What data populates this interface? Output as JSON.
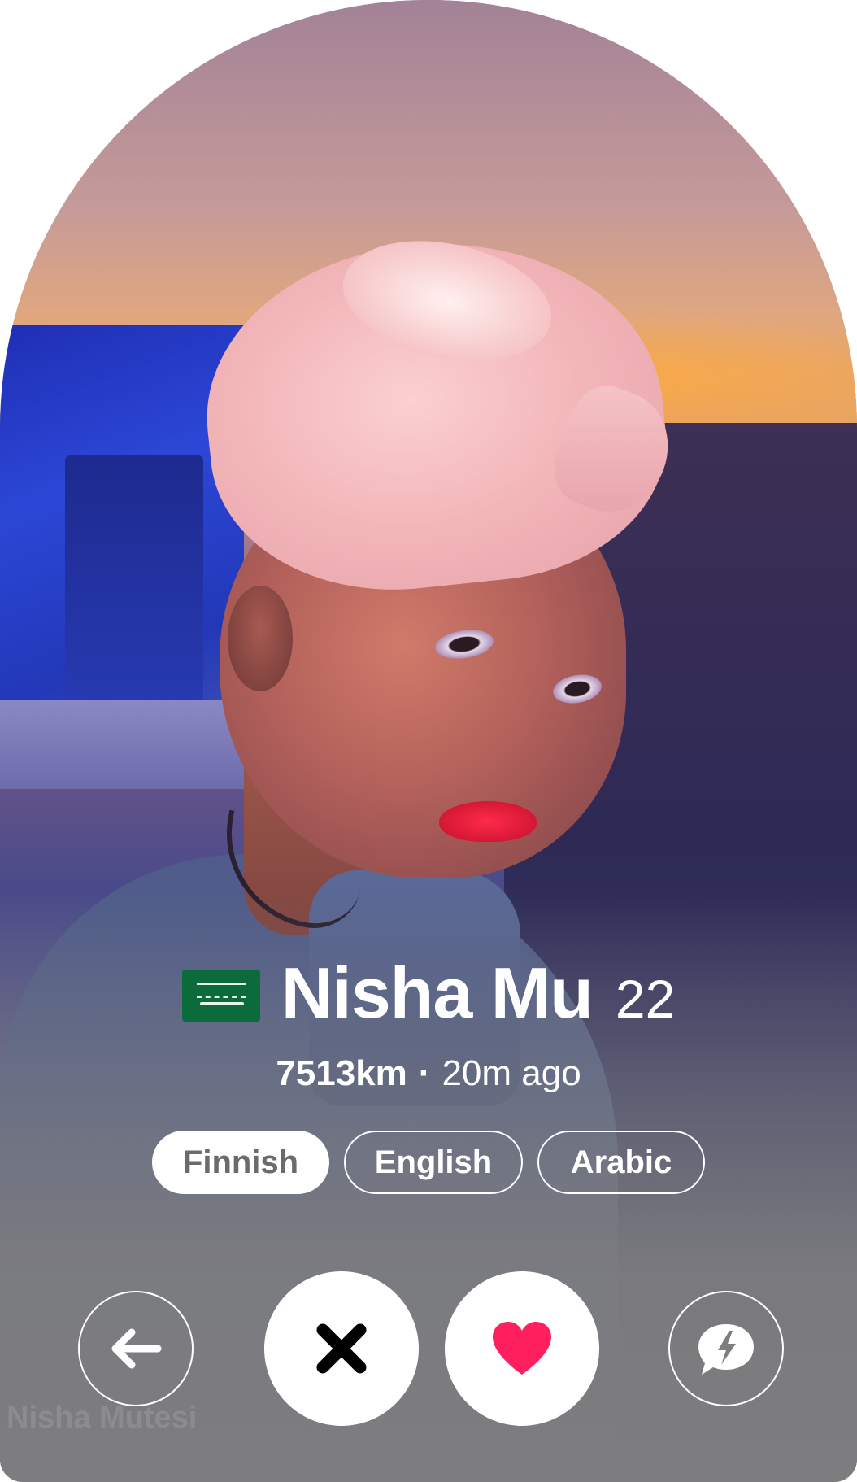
{
  "profile": {
    "flag_icon": "saudi-arabia-flag-icon",
    "name": "Nisha Mu",
    "age": "22",
    "distance": "7513km",
    "separator": "·",
    "last_active": "20m ago",
    "ghost_name": "Nisha Mutesi"
  },
  "languages": [
    {
      "label": "Finnish",
      "selected": true
    },
    {
      "label": "English",
      "selected": false
    },
    {
      "label": "Arabic",
      "selected": false
    }
  ],
  "actions": {
    "back_icon": "arrow-left-icon",
    "nope_icon": "close-x-icon",
    "like_icon": "heart-icon",
    "boost_icon": "lightning-chat-icon"
  },
  "colors": {
    "like": "#ff1f5e",
    "nope": "#000000",
    "flag_green": "#0b6b3a",
    "overlay_gray": "#7d7d7f"
  }
}
